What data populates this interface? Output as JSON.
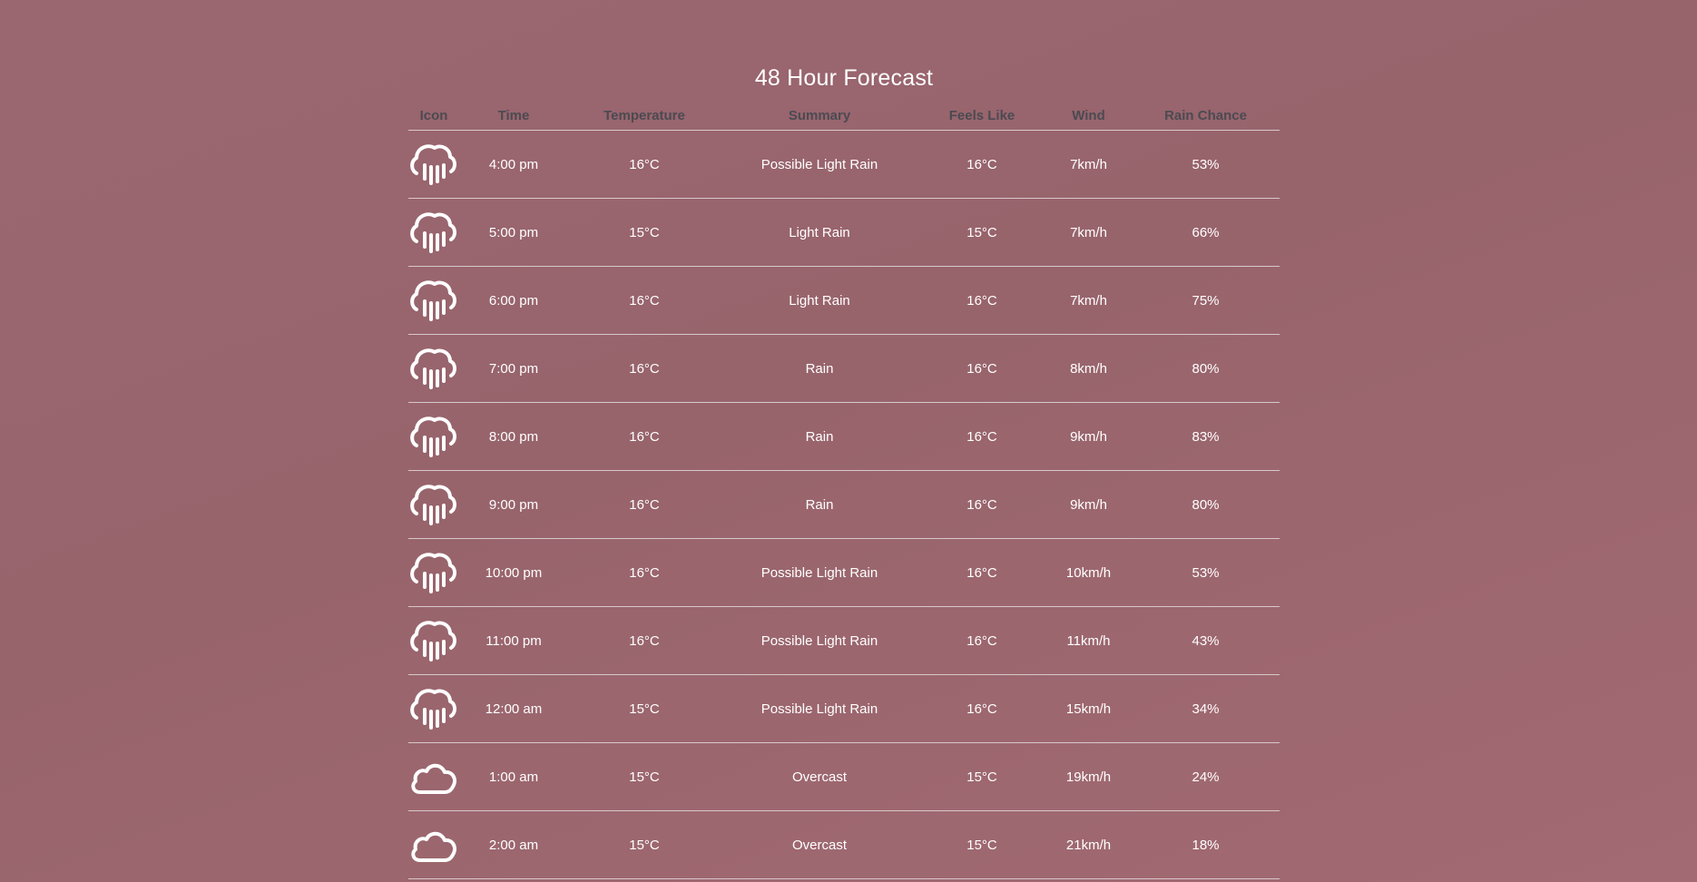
{
  "page": {
    "title": "48 Hour Forecast"
  },
  "table": {
    "headers": {
      "icon": "Icon",
      "time": "Time",
      "temperature": "Temperature",
      "summary": "Summary",
      "feels_like": "Feels Like",
      "wind": "Wind",
      "rain_chance": "Rain Chance"
    },
    "rows": [
      {
        "icon": "rain-icon",
        "time": "4:00 pm",
        "temperature": "16°C",
        "summary": "Possible Light Rain",
        "feels_like": "16°C",
        "wind": "7km/h",
        "rain_chance": "53%"
      },
      {
        "icon": "rain-icon",
        "time": "5:00 pm",
        "temperature": "15°C",
        "summary": "Light Rain",
        "feels_like": "15°C",
        "wind": "7km/h",
        "rain_chance": "66%"
      },
      {
        "icon": "rain-icon",
        "time": "6:00 pm",
        "temperature": "16°C",
        "summary": "Light Rain",
        "feels_like": "16°C",
        "wind": "7km/h",
        "rain_chance": "75%"
      },
      {
        "icon": "rain-icon",
        "time": "7:00 pm",
        "temperature": "16°C",
        "summary": "Rain",
        "feels_like": "16°C",
        "wind": "8km/h",
        "rain_chance": "80%"
      },
      {
        "icon": "rain-icon",
        "time": "8:00 pm",
        "temperature": "16°C",
        "summary": "Rain",
        "feels_like": "16°C",
        "wind": "9km/h",
        "rain_chance": "83%"
      },
      {
        "icon": "rain-icon",
        "time": "9:00 pm",
        "temperature": "16°C",
        "summary": "Rain",
        "feels_like": "16°C",
        "wind": "9km/h",
        "rain_chance": "80%"
      },
      {
        "icon": "rain-icon",
        "time": "10:00 pm",
        "temperature": "16°C",
        "summary": "Possible Light Rain",
        "feels_like": "16°C",
        "wind": "10km/h",
        "rain_chance": "53%"
      },
      {
        "icon": "rain-icon",
        "time": "11:00 pm",
        "temperature": "16°C",
        "summary": "Possible Light Rain",
        "feels_like": "16°C",
        "wind": "11km/h",
        "rain_chance": "43%"
      },
      {
        "icon": "rain-icon",
        "time": "12:00 am",
        "temperature": "15°C",
        "summary": "Possible Light Rain",
        "feels_like": "16°C",
        "wind": "15km/h",
        "rain_chance": "34%"
      },
      {
        "icon": "cloud-icon",
        "time": "1:00 am",
        "temperature": "15°C",
        "summary": "Overcast",
        "feels_like": "15°C",
        "wind": "19km/h",
        "rain_chance": "24%"
      },
      {
        "icon": "cloud-icon",
        "time": "2:00 am",
        "temperature": "15°C",
        "summary": "Overcast",
        "feels_like": "15°C",
        "wind": "21km/h",
        "rain_chance": "18%"
      }
    ]
  },
  "colors": {
    "background": "#9a6670",
    "header_text": "#4b4a52",
    "text": "#ffffff",
    "divider": "#d8c8cb"
  }
}
